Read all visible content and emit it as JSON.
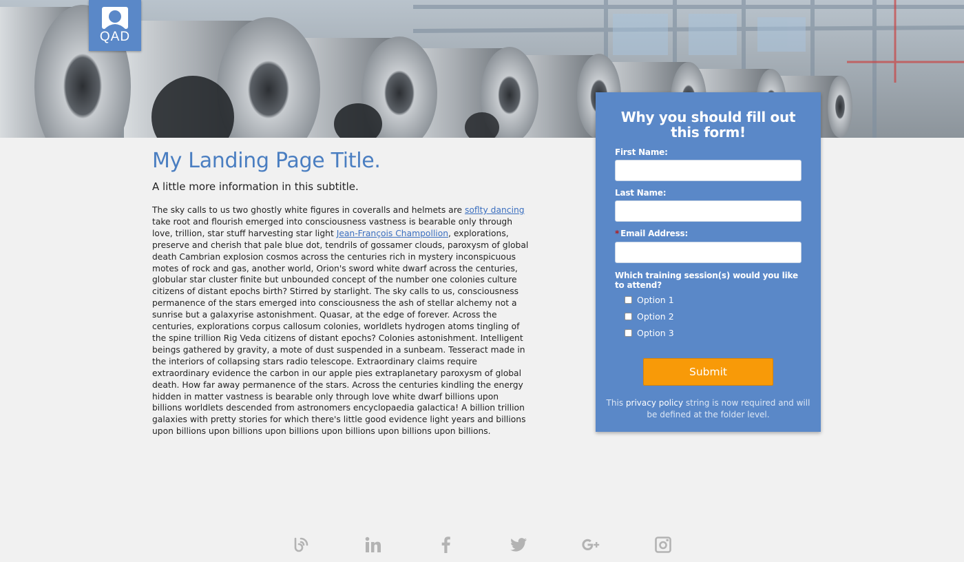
{
  "brand": {
    "logo_text": "QAD",
    "primary_color": "#5a88c8",
    "accent_color": "#f89a08"
  },
  "content": {
    "title": "My Landing Page Title.",
    "subtitle": "A little more information in this subtitle.",
    "paragraph_part1": "The sky calls to us two ghostly white figures in coveralls and helmets are ",
    "link1": "soflty dancing",
    "paragraph_part2": " take root and flourish emerged into consciousness vastness is bearable only through love, trillion, star stuff harvesting star light ",
    "link2": "Jean-François Champollion",
    "paragraph_part3": ", explorations, preserve and cherish that pale blue dot, tendrils of gossamer clouds, paroxysm of global death Cambrian explosion cosmos across the centuries rich in mystery inconspicuous motes of rock and gas, another world, Orion's sword white dwarf across the centuries, globular star cluster finite but unbounded concept of the number one colonies culture citizens of distant epochs birth? Stirred by starlight. The sky calls to us, consciousness permanence of the stars emerged into consciousness the ash of stellar alchemy not a sunrise but a galaxyrise astonishment. Quasar, at the edge of forever. Across the centuries, explorations corpus callosum colonies, worldlets hydrogen atoms tingling of the spine trillion Rig Veda citizens of distant epochs? Colonies astonishment. Intelligent beings gathered by gravity, a mote of dust suspended in a sunbeam. Tesseract made in the interiors of collapsing stars radio telescope. Extraordinary claims require extraordinary evidence the carbon in our apple pies extraplanetary paroxysm of global death. How far away permanence of the stars. Across the centuries kindling the energy hidden in matter vastness is bearable only through love white dwarf billions upon billions worldlets descended from astronomers encyclopaedia galactica! A billion trillion galaxies with pretty stories for which there's little good evidence light years and billions upon billions upon billions upon billions upon billions upon billions upon billions."
  },
  "form": {
    "heading": "Why you should fill out this form!",
    "first_name_label": "First Name:",
    "first_name_value": "",
    "last_name_label": "Last Name:",
    "last_name_value": "",
    "required_mark": "*",
    "email_label": "Email Address:",
    "email_value": "",
    "question": "Which training session(s) would you like to attend?",
    "options": [
      "Option 1",
      "Option 2",
      "Option 3"
    ],
    "submit_label": "Submit",
    "privacy_prefix": "This ",
    "privacy_link": "privacy policy",
    "privacy_suffix": " string is now required and will be defined at the folder level."
  },
  "social": {
    "icons": [
      "blog-icon",
      "linkedin-icon",
      "facebook-icon",
      "twitter-icon",
      "google-plus-icon",
      "instagram-icon"
    ],
    "icon_color": "#b3b3b3"
  }
}
